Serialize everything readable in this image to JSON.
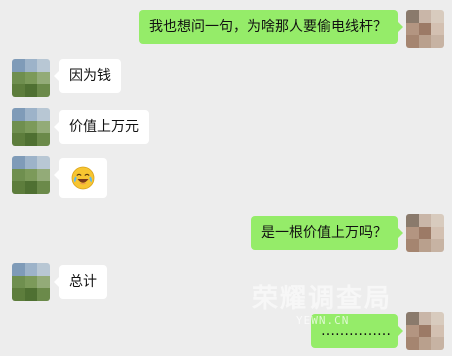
{
  "messages": [
    {
      "from": "me",
      "text": "我也想问一句，为啥那人要偷电线杆？"
    },
    {
      "from": "other",
      "text": "因为钱"
    },
    {
      "from": "other",
      "text": "价值上万元"
    },
    {
      "from": "other",
      "emoji": "laughing-crying-emoji"
    },
    {
      "from": "me",
      "text": "是一根价值上万吗？"
    },
    {
      "from": "other",
      "text": "总计"
    },
    {
      "from": "me",
      "text": "……………"
    }
  ],
  "watermark": {
    "brand": "荣耀调查局",
    "site": "YEWN.CN"
  },
  "colors": {
    "background": "#ededed",
    "sent_bubble": "#95ec69",
    "received_bubble": "#ffffff"
  }
}
